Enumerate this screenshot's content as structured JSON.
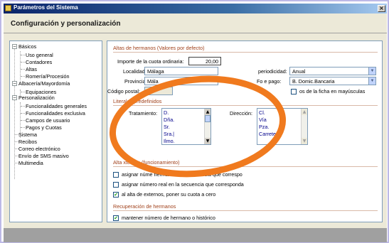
{
  "window": {
    "title": "Parámetros del Sistema",
    "close_symbol": "×",
    "heading": "Configuración y personalización"
  },
  "tree": {
    "items": [
      {
        "label": "Básicos",
        "expander": "−"
      },
      {
        "label": "Uso general"
      },
      {
        "label": "Contadores"
      },
      {
        "label": "Altas"
      },
      {
        "label": "Romería/Procesión"
      },
      {
        "label": "Albacería/Mayordomía",
        "expander": "−"
      },
      {
        "label": "Equipaciones"
      },
      {
        "label": "Personalización",
        "expander": "−"
      },
      {
        "label": "Funcionalidades generales"
      },
      {
        "label": "Funcionalidades exclusiva"
      },
      {
        "label": "Campos de usuario"
      },
      {
        "label": "Pagos y Cuotas"
      },
      {
        "label": "Sistema"
      },
      {
        "label": "Recibos"
      },
      {
        "label": "Correo electrónico"
      },
      {
        "label": "Envío de SMS masivo"
      },
      {
        "label": "Multimedia"
      }
    ]
  },
  "altas": {
    "group_title": "Altas de hermanos (Valores por defecto)",
    "cuota_label": "Importe de la cuota ordinaria:",
    "cuota_value": "20,00",
    "localidad_label": "Localidad:",
    "localidad_value": "Málaga",
    "provincia_label": "Provincia:",
    "provincia_value": "Mála",
    "codigo_label": "Código postal:",
    "codigo_value": "",
    "periodicidad_label": "periodicidad:",
    "periodicidad_value": "Anual",
    "forma_pago_label": "Forma de pago:",
    "forma_pago_label_visible": "Fo         e pago:",
    "forma_pago_value": "B. Domic.Bancaria",
    "mayusculas_label": "Datos de la ficha en mayúsculas",
    "mayusculas_label_visible": "os de la ficha en mayúsculas",
    "mayusculas_checked": false
  },
  "literales": {
    "group_title": "Literales predefinidos",
    "tratamiento_label": "Tratamiento:",
    "tratamiento_items": [
      "D.",
      "Dña.",
      "Sr.",
      "Sra.|",
      "Ilmo."
    ],
    "direccion_label": "Dirección:",
    "direccion_items": [
      "Cl.",
      "Vía",
      "Pza.",
      "Carretera"
    ]
  },
  "externos": {
    "group_title": "Altas de externos (funcionamiento)",
    "group_title_visible": "Alta         xternos (funcionamiento)",
    "options": [
      {
        "label": "asignar número de hermano en la secuencia que corresponda",
        "visible": "asignar núme              hermano en la secuencia que correspo",
        "checked": false
      },
      {
        "label": "asignar número real en la secuencia que corresponda",
        "visible": "asignar número real en la secuencia que corresponda",
        "checked": false
      },
      {
        "label": "al alta de externos, poner su cuota a cero",
        "visible": "al alta de externos, poner su cuota a cero",
        "checked": true
      }
    ]
  },
  "recuperacion": {
    "group_title": "Recuperación de hermanos",
    "option_label": "mantener número de hermano o histórico",
    "checked": true
  },
  "colors": {
    "annotation_ellipse": "#f07a1e",
    "group_title": "#a0401a",
    "titlebar_start": "#0a246a",
    "list_text": "#00008b",
    "check": "#21a121"
  },
  "icons": {
    "app": "app-icon",
    "close": "close-icon",
    "check": "checkmark-icon",
    "dropdown": "chevron-down-icon",
    "scroll_up": "scroll-up-icon",
    "scroll_down": "scroll-down-icon"
  }
}
